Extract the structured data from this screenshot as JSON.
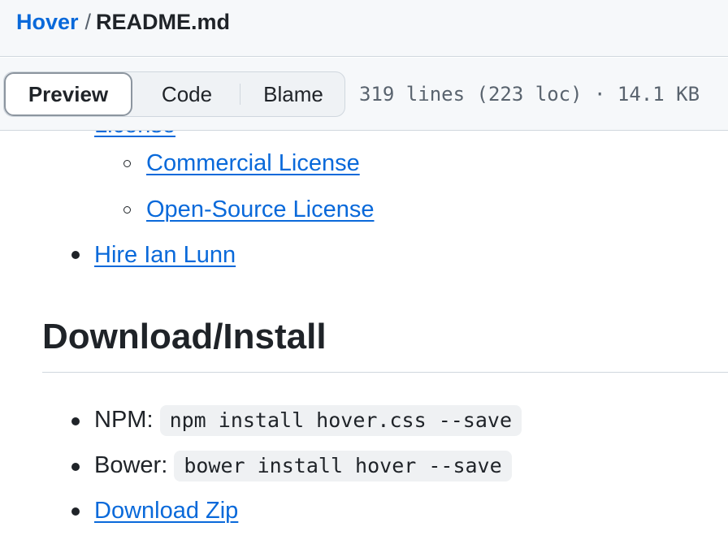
{
  "breadcrumb": {
    "repo": "Hover",
    "separator": "/",
    "file": "README.md"
  },
  "toolbar": {
    "tabs": [
      {
        "label": "Preview",
        "active": true
      },
      {
        "label": "Code",
        "active": false
      },
      {
        "label": "Blame",
        "active": false
      }
    ],
    "file_info": "319 lines (223 loc) · 14.1 KB"
  },
  "content": {
    "partial_link": "License",
    "sub_links": [
      "Commercial License",
      "Open-Source License"
    ],
    "hire_link": "Hire Ian Lunn",
    "heading": "Download/Install",
    "install_items": [
      {
        "label": "NPM:",
        "code": "npm install hover.css --save"
      },
      {
        "label": "Bower:",
        "code": "bower install hover --save"
      }
    ],
    "download_link": "Download Zip"
  },
  "colors": {
    "link": "#0969da",
    "text": "#1f2328",
    "toolbar_bg": "#f6f8fa",
    "border": "#d0d7de"
  }
}
